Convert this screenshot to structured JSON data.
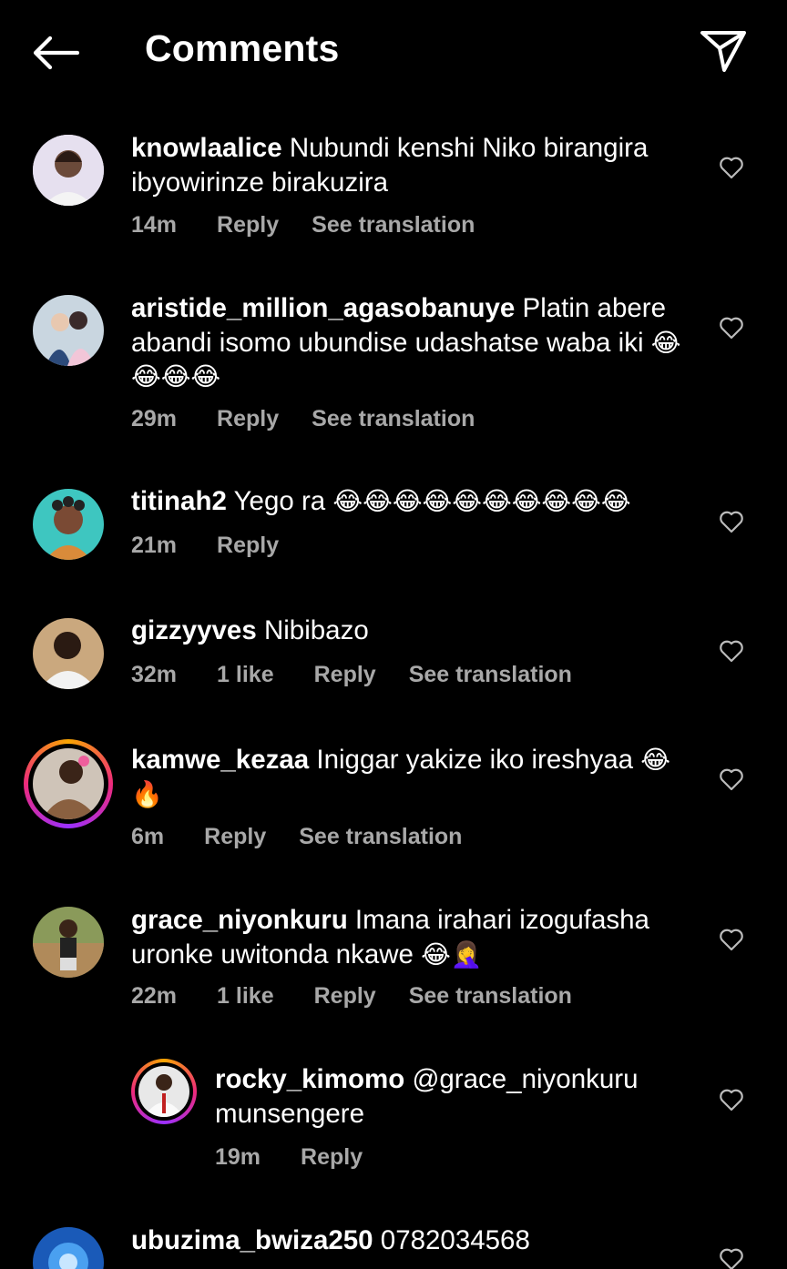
{
  "header": {
    "title": "Comments",
    "back_icon": "arrow-left-icon",
    "share_icon": "paper-plane-icon"
  },
  "comments": [
    {
      "username": "knowlaalice",
      "text": "Nubundi kenshi Niko birangira ibyowirinze birakuzira",
      "emoji": "",
      "time": "14m",
      "likes": "",
      "reply": "Reply",
      "translate": "See translation"
    },
    {
      "username": "aristide_million_agasobanuye",
      "text": "Platin abere abandi isomo ubundise udashatse waba iki",
      "emoji": "😂😂😂😂",
      "time": "29m",
      "likes": "",
      "reply": "Reply",
      "translate": "See translation"
    },
    {
      "username": "titinah2",
      "text": "Yego ra",
      "emoji": "😂😂😂😂😂😂😂😂😂😂",
      "time": "21m",
      "likes": "",
      "reply": "Reply",
      "translate": ""
    },
    {
      "username": "gizzyyves",
      "text": "Nibibazo",
      "emoji": "",
      "time": "32m",
      "likes": "1 like",
      "reply": "Reply",
      "translate": "See translation"
    },
    {
      "username": "kamwe_kezaa",
      "text": "Iniggar yakize iko ireshyaa",
      "emoji": "😂 🔥",
      "time": "6m",
      "likes": "",
      "reply": "Reply",
      "translate": "See translation"
    },
    {
      "username": "grace_niyonkuru",
      "text": "Imana irahari izogufasha uronke uwitonda nkawe",
      "emoji": "😂🤦‍♀️",
      "time": "22m",
      "likes": "1 like",
      "reply": "Reply",
      "translate": "See translation"
    },
    {
      "username": "rocky_kimomo",
      "text": "@grace_niyonkuru munsengere",
      "emoji": "",
      "time": "19m",
      "likes": "",
      "reply": "Reply",
      "translate": ""
    },
    {
      "username": "ubuzima_bwiza250",
      "text": "0782034568",
      "emoji": "",
      "time": "",
      "likes": "",
      "reply": "",
      "translate": ""
    }
  ],
  "colors": {
    "background": "#000000",
    "text": "#ffffff",
    "meta": "#a8a8a8",
    "story_ring": "#ee2a7b"
  }
}
